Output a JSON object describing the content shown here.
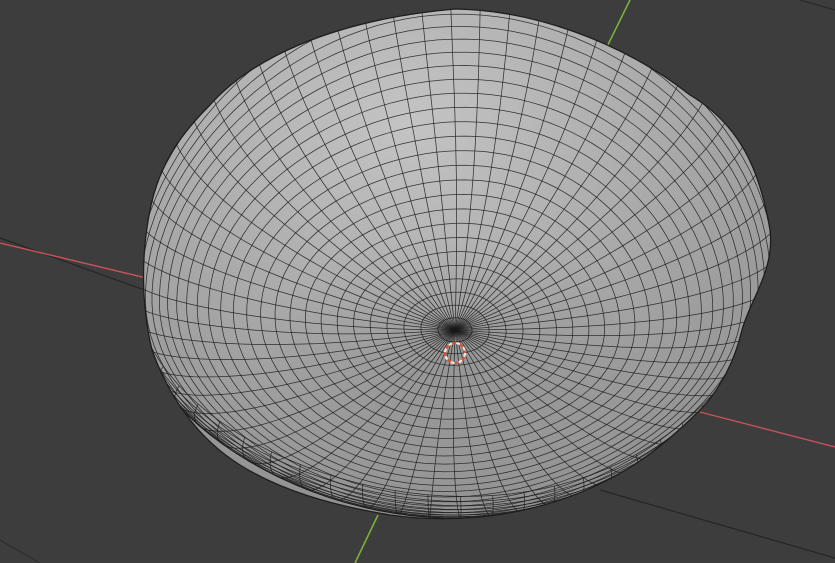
{
  "viewport": {
    "background_color": "#3d3d3d",
    "shading": "solid",
    "overlay": "wireframe",
    "view": "perspective"
  },
  "scene": {
    "mesh": {
      "type": "deformed sphere",
      "base_color": "#a9a9a9",
      "wire_color": "#1a1a1a"
    },
    "axes": {
      "x_color": "#c8525a",
      "y_color": "#7ab037"
    },
    "grid_line_color": "#262626",
    "cursor_icon": "3d-cursor-icon",
    "cursor_colors": [
      "#e8e8e8",
      "#d94f2f"
    ]
  }
}
